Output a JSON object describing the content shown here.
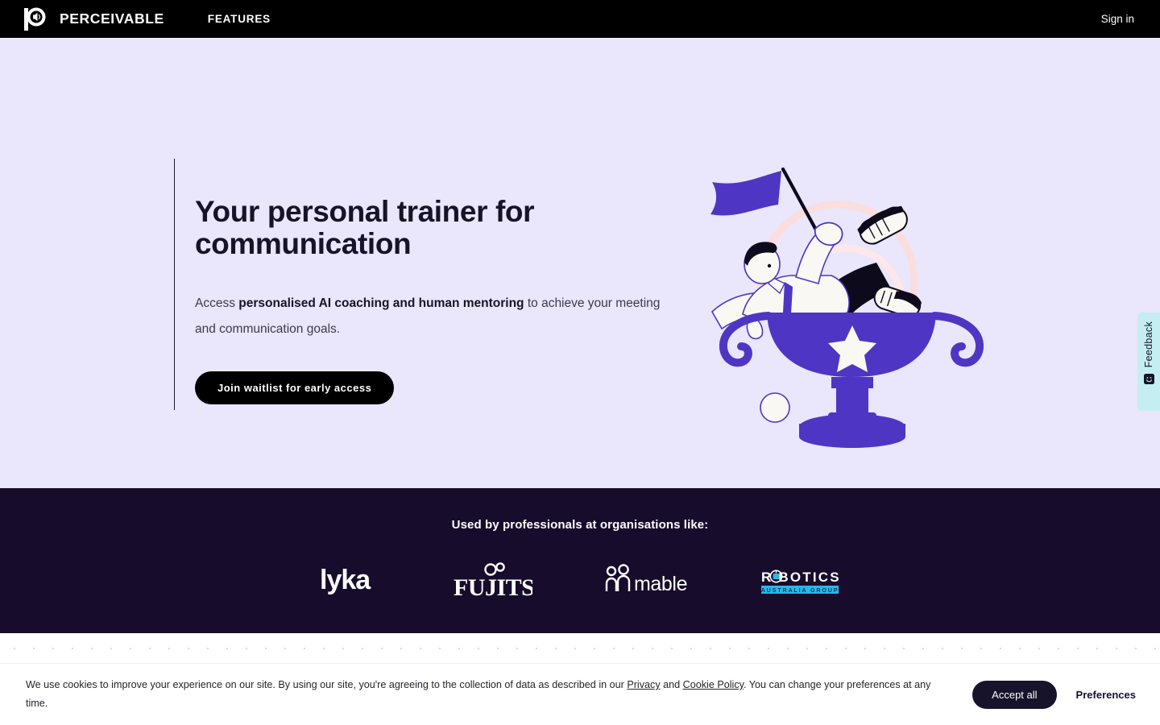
{
  "nav": {
    "brand_name": "PERCEIVABLE",
    "logo_icon": "perceivable-p-speaker-logo",
    "features_label": "FEATURES",
    "signin_label": "Sign in"
  },
  "hero": {
    "title": "Your personal trainer for communication",
    "subtitle_lead": "Access ",
    "subtitle_bold": "personalised AI coaching and human mentoring",
    "subtitle_tail": " to achieve your meeting and communication goals.",
    "cta_label": "Join waitlist for early access",
    "illustration_name": "person-in-trophy-waving-flag-illustration",
    "background_color": "#EAE6FB",
    "accent_purple": "#4F35C4",
    "accent_pink": "#FBE3E4"
  },
  "logoband": {
    "title": "Used by professionals at organisations like:",
    "background_color": "#170C2B",
    "logos": [
      {
        "name": "lyka",
        "icon": "lyka-wordmark-logo"
      },
      {
        "name": "FUJITSU",
        "icon": "fujitsu-wordmark-logo"
      },
      {
        "name": "mable",
        "icon": "mable-people-logo"
      },
      {
        "name": "ROBOTICS",
        "sub": "AUSTRALIA GROUP",
        "icon": "robotics-australia-group-logo"
      }
    ]
  },
  "cookie": {
    "text_part1": "We use cookies to improve your experience on our site. By using our site, you're agreeing to the collection of data as described in our ",
    "privacy_link": "Privacy",
    "text_and": " and ",
    "cookie_policy_link": "Cookie Policy",
    "text_part2": ". You can change your preferences at any time.",
    "accept_label": "Accept all",
    "preferences_label": "Preferences"
  },
  "feedback": {
    "label": "Feedback",
    "icon": "smiley-face-icon",
    "background_color": "#C5EEF2"
  }
}
